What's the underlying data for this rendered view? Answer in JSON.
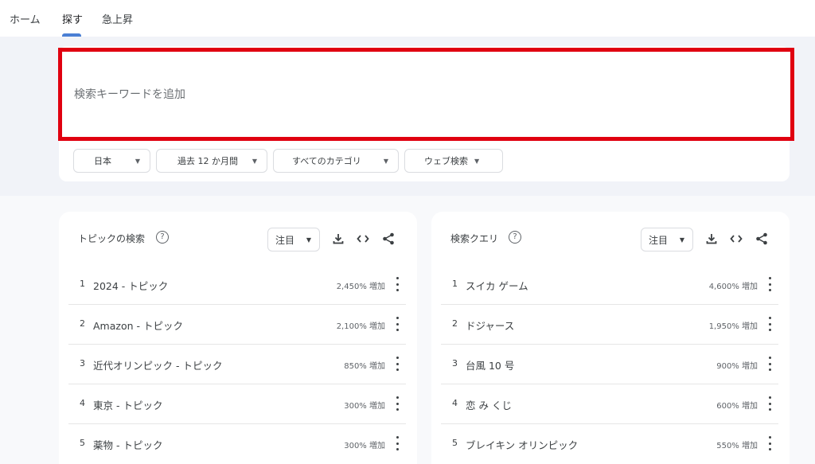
{
  "nav": {
    "tabs": [
      {
        "label": "ホーム"
      },
      {
        "label": "探す"
      },
      {
        "label": "急上昇"
      }
    ],
    "active_index": 1
  },
  "search": {
    "placeholder": "検索キーワードを追加"
  },
  "filters": [
    {
      "label": "日本"
    },
    {
      "label": "過去 12 か月間"
    },
    {
      "label": "すべてのカテゴリ"
    },
    {
      "label": "ウェブ検索"
    }
  ],
  "panels": [
    {
      "title": "トピックの検索",
      "sort_label": "注目",
      "rows": [
        {
          "rank": "1",
          "label": "2024 - トピック",
          "growth": "2,450% 増加"
        },
        {
          "rank": "2",
          "label": "Amazon - トピック",
          "growth": "2,100% 増加"
        },
        {
          "rank": "3",
          "label": "近代オリンピック - トピック",
          "growth": "850% 増加"
        },
        {
          "rank": "4",
          "label": "東京 - トピック",
          "growth": "300% 増加"
        },
        {
          "rank": "5",
          "label": "薬物 - トピック",
          "growth": "300% 増加"
        }
      ]
    },
    {
      "title": "検索クエリ",
      "sort_label": "注目",
      "rows": [
        {
          "rank": "1",
          "label": "スイカ ゲーム",
          "growth": "4,600% 増加"
        },
        {
          "rank": "2",
          "label": "ドジャース",
          "growth": "1,950% 増加"
        },
        {
          "rank": "3",
          "label": "台風 10 号",
          "growth": "900% 増加"
        },
        {
          "rank": "4",
          "label": "恋 み くじ",
          "growth": "600% 増加"
        },
        {
          "rank": "5",
          "label": "ブレイキン オリンピック",
          "growth": "550% 増加"
        }
      ]
    }
  ],
  "colors": {
    "highlight_border": "#e00010",
    "active_tab_underline": "#4a7fd4",
    "background_band": "#f1f3f8"
  },
  "icons": [
    "help-icon",
    "download-icon",
    "embed-icon",
    "share-icon",
    "more-vert-icon",
    "caret-down-icon"
  ]
}
